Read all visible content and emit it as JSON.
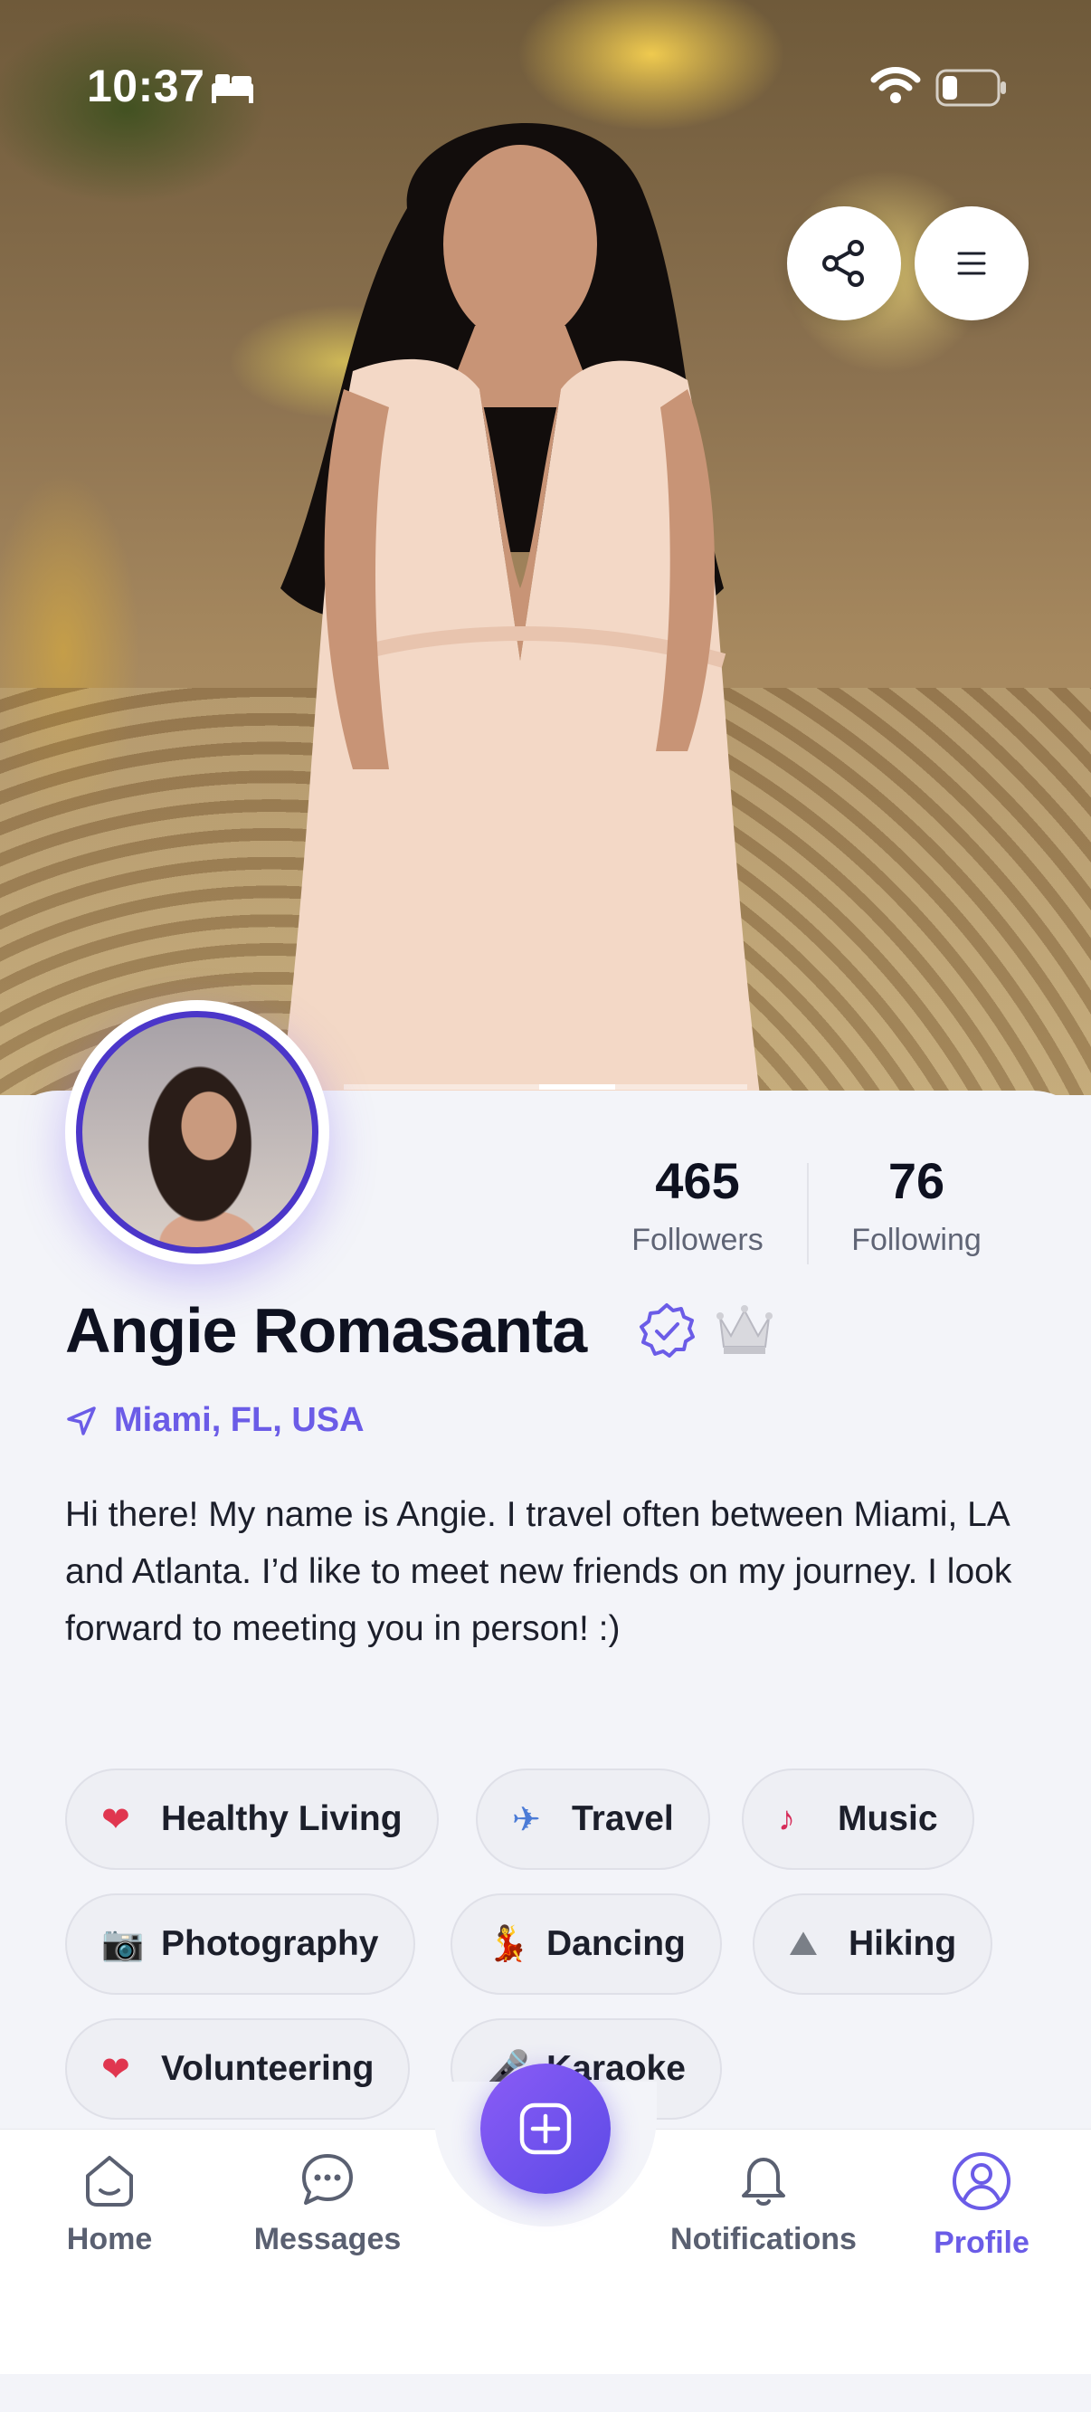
{
  "status_bar": {
    "time": "10:37"
  },
  "profile": {
    "followers_count": "465",
    "followers_label": "Followers",
    "following_count": "76",
    "following_label": "Following",
    "name": "Angie Romasanta",
    "location": "Miami, FL, USA",
    "bio": "Hi there! My name is Angie. I travel often between Miami, LA and Atlanta. I’d like to meet new friends on my journey. I look forward to meeting you in person! :)"
  },
  "interests": [
    {
      "label": "Healthy Living",
      "icon": "heartbeat-icon",
      "glyph": "❤"
    },
    {
      "label": "Travel",
      "icon": "airplane-icon",
      "glyph": "✈"
    },
    {
      "label": "Music",
      "icon": "music-note-icon",
      "glyph": "♪"
    },
    {
      "label": "Photography",
      "icon": "camera-icon",
      "glyph": "📷"
    },
    {
      "label": "Dancing",
      "icon": "dancer-icon",
      "glyph": "💃"
    },
    {
      "label": "Hiking",
      "icon": "mountain-icon",
      "glyph": "⛰"
    },
    {
      "label": "Volunteering",
      "icon": "hand-heart-icon",
      "glyph": "❤"
    },
    {
      "label": "Karaoke",
      "icon": "microphone-icon",
      "glyph": "🎤"
    }
  ],
  "nav": {
    "home": "Home",
    "messages": "Messages",
    "notifications": "Notifications",
    "profile": "Profile"
  },
  "colors": {
    "accent": "#6b5ce7",
    "text": "#0e1120",
    "chip_bg": "#eeeff4"
  }
}
